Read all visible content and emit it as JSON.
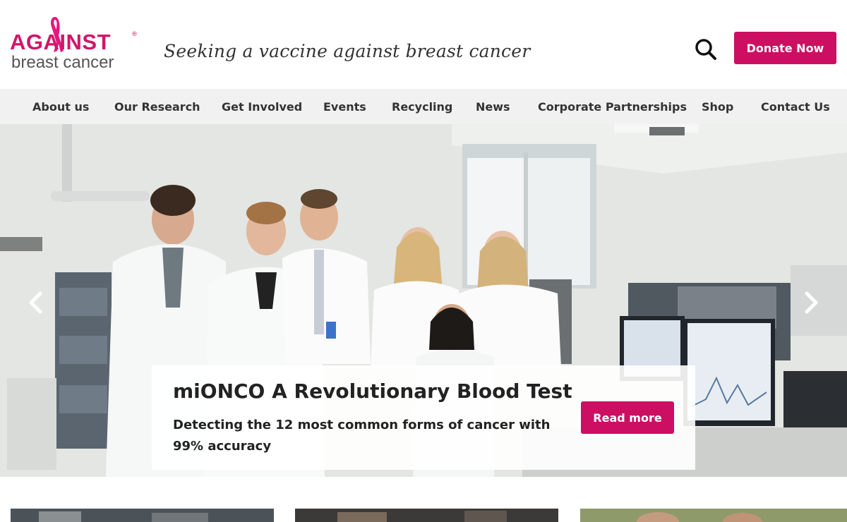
{
  "header": {
    "logo_top": "AGAINST",
    "logo_reg": "®",
    "logo_bottom": "breast cancer",
    "tagline": "Seeking a vaccine against breast cancer",
    "donate_label": "Donate Now"
  },
  "nav": {
    "items": [
      {
        "label": "About us"
      },
      {
        "label": "Our Research"
      },
      {
        "label": "Get Involved"
      },
      {
        "label": "Events"
      },
      {
        "label": "Recycling"
      },
      {
        "label": "News"
      },
      {
        "label": "Corporate Partnerships"
      },
      {
        "label": "Shop"
      },
      {
        "label": "Contact Us"
      }
    ]
  },
  "hero": {
    "title": "miONCO A Revolutionary Blood Test",
    "subtitle": "Detecting the 12 most common forms of cancer with 99% accuracy",
    "cta_label": "Read more"
  },
  "icons": {
    "search": "search-icon",
    "prev": "chevron-left-icon",
    "next": "chevron-right-icon",
    "ribbon": "pink-ribbon-icon"
  },
  "colors": {
    "brand": "#cc0f62",
    "nav_bg": "#f1f1f1"
  }
}
